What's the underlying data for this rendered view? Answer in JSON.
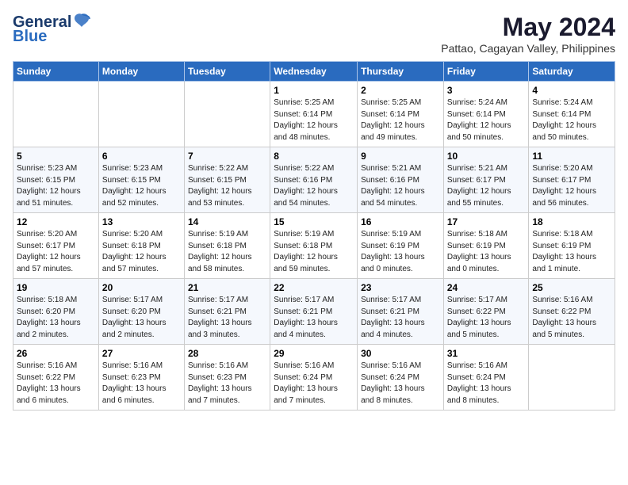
{
  "logo": {
    "line1": "General",
    "line2": "Blue"
  },
  "title": "May 2024",
  "location": "Pattao, Cagayan Valley, Philippines",
  "days_of_week": [
    "Sunday",
    "Monday",
    "Tuesday",
    "Wednesday",
    "Thursday",
    "Friday",
    "Saturday"
  ],
  "weeks": [
    [
      {
        "num": "",
        "info": ""
      },
      {
        "num": "",
        "info": ""
      },
      {
        "num": "",
        "info": ""
      },
      {
        "num": "1",
        "info": "Sunrise: 5:25 AM\nSunset: 6:14 PM\nDaylight: 12 hours\nand 48 minutes."
      },
      {
        "num": "2",
        "info": "Sunrise: 5:25 AM\nSunset: 6:14 PM\nDaylight: 12 hours\nand 49 minutes."
      },
      {
        "num": "3",
        "info": "Sunrise: 5:24 AM\nSunset: 6:14 PM\nDaylight: 12 hours\nand 50 minutes."
      },
      {
        "num": "4",
        "info": "Sunrise: 5:24 AM\nSunset: 6:14 PM\nDaylight: 12 hours\nand 50 minutes."
      }
    ],
    [
      {
        "num": "5",
        "info": "Sunrise: 5:23 AM\nSunset: 6:15 PM\nDaylight: 12 hours\nand 51 minutes."
      },
      {
        "num": "6",
        "info": "Sunrise: 5:23 AM\nSunset: 6:15 PM\nDaylight: 12 hours\nand 52 minutes."
      },
      {
        "num": "7",
        "info": "Sunrise: 5:22 AM\nSunset: 6:15 PM\nDaylight: 12 hours\nand 53 minutes."
      },
      {
        "num": "8",
        "info": "Sunrise: 5:22 AM\nSunset: 6:16 PM\nDaylight: 12 hours\nand 54 minutes."
      },
      {
        "num": "9",
        "info": "Sunrise: 5:21 AM\nSunset: 6:16 PM\nDaylight: 12 hours\nand 54 minutes."
      },
      {
        "num": "10",
        "info": "Sunrise: 5:21 AM\nSunset: 6:17 PM\nDaylight: 12 hours\nand 55 minutes."
      },
      {
        "num": "11",
        "info": "Sunrise: 5:20 AM\nSunset: 6:17 PM\nDaylight: 12 hours\nand 56 minutes."
      }
    ],
    [
      {
        "num": "12",
        "info": "Sunrise: 5:20 AM\nSunset: 6:17 PM\nDaylight: 12 hours\nand 57 minutes."
      },
      {
        "num": "13",
        "info": "Sunrise: 5:20 AM\nSunset: 6:18 PM\nDaylight: 12 hours\nand 57 minutes."
      },
      {
        "num": "14",
        "info": "Sunrise: 5:19 AM\nSunset: 6:18 PM\nDaylight: 12 hours\nand 58 minutes."
      },
      {
        "num": "15",
        "info": "Sunrise: 5:19 AM\nSunset: 6:18 PM\nDaylight: 12 hours\nand 59 minutes."
      },
      {
        "num": "16",
        "info": "Sunrise: 5:19 AM\nSunset: 6:19 PM\nDaylight: 13 hours\nand 0 minutes."
      },
      {
        "num": "17",
        "info": "Sunrise: 5:18 AM\nSunset: 6:19 PM\nDaylight: 13 hours\nand 0 minutes."
      },
      {
        "num": "18",
        "info": "Sunrise: 5:18 AM\nSunset: 6:19 PM\nDaylight: 13 hours\nand 1 minute."
      }
    ],
    [
      {
        "num": "19",
        "info": "Sunrise: 5:18 AM\nSunset: 6:20 PM\nDaylight: 13 hours\nand 2 minutes."
      },
      {
        "num": "20",
        "info": "Sunrise: 5:17 AM\nSunset: 6:20 PM\nDaylight: 13 hours\nand 2 minutes."
      },
      {
        "num": "21",
        "info": "Sunrise: 5:17 AM\nSunset: 6:21 PM\nDaylight: 13 hours\nand 3 minutes."
      },
      {
        "num": "22",
        "info": "Sunrise: 5:17 AM\nSunset: 6:21 PM\nDaylight: 13 hours\nand 4 minutes."
      },
      {
        "num": "23",
        "info": "Sunrise: 5:17 AM\nSunset: 6:21 PM\nDaylight: 13 hours\nand 4 minutes."
      },
      {
        "num": "24",
        "info": "Sunrise: 5:17 AM\nSunset: 6:22 PM\nDaylight: 13 hours\nand 5 minutes."
      },
      {
        "num": "25",
        "info": "Sunrise: 5:16 AM\nSunset: 6:22 PM\nDaylight: 13 hours\nand 5 minutes."
      }
    ],
    [
      {
        "num": "26",
        "info": "Sunrise: 5:16 AM\nSunset: 6:22 PM\nDaylight: 13 hours\nand 6 minutes."
      },
      {
        "num": "27",
        "info": "Sunrise: 5:16 AM\nSunset: 6:23 PM\nDaylight: 13 hours\nand 6 minutes."
      },
      {
        "num": "28",
        "info": "Sunrise: 5:16 AM\nSunset: 6:23 PM\nDaylight: 13 hours\nand 7 minutes."
      },
      {
        "num": "29",
        "info": "Sunrise: 5:16 AM\nSunset: 6:24 PM\nDaylight: 13 hours\nand 7 minutes."
      },
      {
        "num": "30",
        "info": "Sunrise: 5:16 AM\nSunset: 6:24 PM\nDaylight: 13 hours\nand 8 minutes."
      },
      {
        "num": "31",
        "info": "Sunrise: 5:16 AM\nSunset: 6:24 PM\nDaylight: 13 hours\nand 8 minutes."
      },
      {
        "num": "",
        "info": ""
      }
    ]
  ]
}
